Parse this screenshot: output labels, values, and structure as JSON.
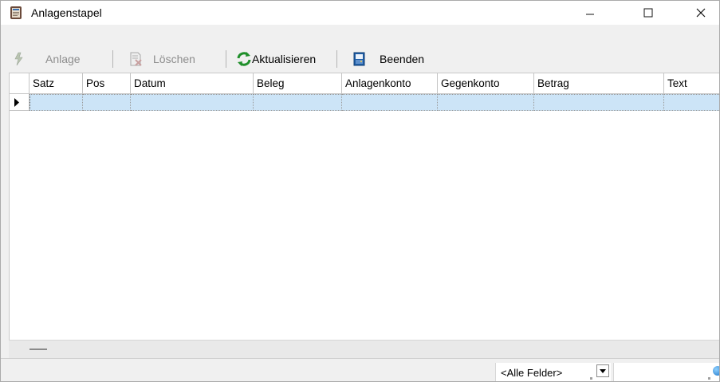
{
  "window": {
    "title": "Anlagenstapel",
    "icon": "ledger-book-icon"
  },
  "toolbar": {
    "items": [
      {
        "label": "Anlage",
        "icon": "lightning-icon",
        "enabled": false
      },
      {
        "label": "Löschen",
        "icon": "delete-document-icon",
        "enabled": false
      },
      {
        "label": "Aktualisieren",
        "icon": "refresh-icon",
        "enabled": true
      },
      {
        "label": "Beenden",
        "icon": "exit-door-icon",
        "enabled": true
      }
    ]
  },
  "grid": {
    "columns": [
      "Satz",
      "Pos",
      "Datum",
      "Beleg",
      "Anlagenkonto",
      "Gegenkonto",
      "Betrag",
      "Text"
    ],
    "rows": [
      {
        "cells": [
          "",
          "",
          "",
          "",
          "",
          "",
          "",
          ""
        ],
        "selected": true
      }
    ],
    "selection_color": "#cce4f7"
  },
  "statusbar": {
    "filter_field": "<Alle Felder>",
    "search_value": ""
  }
}
